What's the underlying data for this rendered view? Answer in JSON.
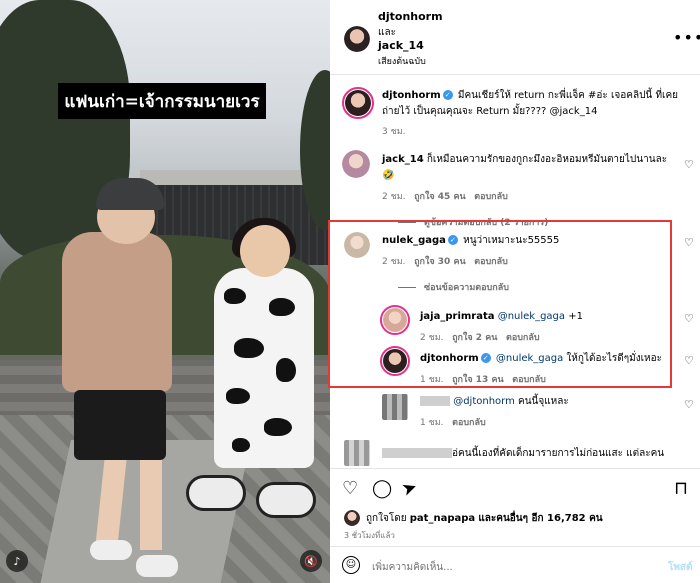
{
  "video": {
    "caption": "แฟนเก่า=เจ้ากรรมนายเวร",
    "audio_icon": "audio-icon",
    "mute_icon": "mute-icon"
  },
  "header": {
    "user1": "djtonhorm",
    "and_text": "และ",
    "user2": "jack_14",
    "audio_label": "เสียงต้นฉบับ",
    "more_icon": "more-icon"
  },
  "post": {
    "username": "djtonhorm",
    "caption": "มีคนเชียร์ให้ return กะพี่แจ็ค #อ่ะ เจอคลิปนี้ ที่เคยถ่ายไว้ เป็นคุณคุณจะ Return มั้ย???? @jack_14",
    "time": "3 ชม."
  },
  "comments": [
    {
      "username": "jack_14",
      "text": "ก็เหมือนความรักของกูกะมึงอะอิหอมหรีมันตายไปนานละ 🤣",
      "time": "2 ชม.",
      "likes": "ถูกใจ 45 คน",
      "reply": "ตอบกลับ",
      "view_replies": "ดูข้อความตอบกลับ (2 รายการ)"
    },
    {
      "username": "nulek_gaga",
      "text": "หนูว่าเหมาะนะ55555",
      "time": "2 ชม.",
      "likes": "ถูกใจ 30 คน",
      "reply": "ตอบกลับ",
      "hide_replies": "ซ่อนข้อความตอบกลับ",
      "replies": [
        {
          "username": "jaja_primrata",
          "mention": "@nulek_gaga",
          "text": " +1",
          "time": "2 ชม.",
          "likes": "ถูกใจ 2 คน",
          "reply": "ตอบกลับ"
        },
        {
          "username": "djtonhorm",
          "mention": "@nulek_gaga",
          "text": " ให้กูได้อะไรดีๆมั่งเหอะ",
          "time": "1 ชม.",
          "likes": "ถูกใจ 13 คน",
          "reply": "ตอบกลับ"
        }
      ]
    },
    {
      "username": "",
      "mention": "@djtonhorm",
      "text": " คนนี้จุแหละ",
      "time": "1 ชม.",
      "reply": "ตอบกลับ"
    },
    {
      "username": "",
      "text": "อ่คนนี้เองที่คัดเด็กมารายการไม่ก่อนแสะ แต่ละคน"
    }
  ],
  "footer": {
    "liked_by_prefix": "ถูกใจโดย",
    "liked_by_user": "pat_napapa",
    "liked_by_suffix": "และคนอื่นๆ อีก 16,782 คน",
    "time": "3 ชั่วโมงที่แล้ว",
    "comment_placeholder": "เพิ่มความคิดเห็น...",
    "post_label": "โพสต์"
  },
  "colors": {
    "highlight_border": "#e53935",
    "verified": "#3897f0",
    "mention": "#00376b",
    "story_ring": "#e2328c"
  }
}
